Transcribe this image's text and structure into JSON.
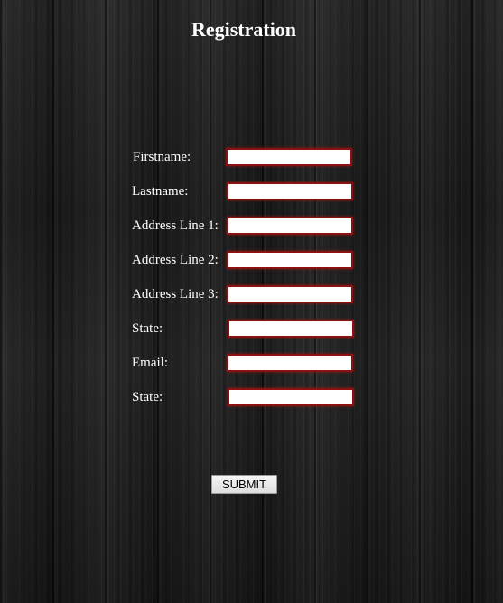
{
  "page": {
    "title": "Registration",
    "background": "#1c1c1c",
    "accent": "#8b1212"
  },
  "form": {
    "fields": [
      {
        "label": "Firstname:",
        "value": ""
      },
      {
        "label": "Lastname:",
        "value": ""
      },
      {
        "label": "Address Line 1:",
        "value": ""
      },
      {
        "label": "Address Line 2:",
        "value": ""
      },
      {
        "label": "Address Line 3:",
        "value": ""
      },
      {
        "label": "State:",
        "value": ""
      },
      {
        "label": "Email:",
        "value": ""
      },
      {
        "label": "State:",
        "value": ""
      }
    ],
    "submit_label": "SUBMIT"
  }
}
